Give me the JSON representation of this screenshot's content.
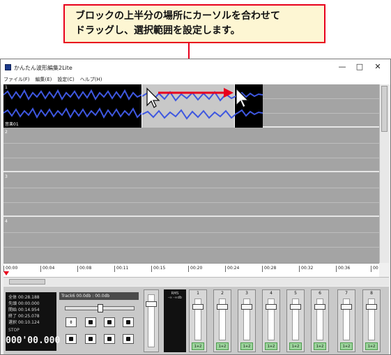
{
  "callout": {
    "line1": "ブロックの上半分の場所にカーソルを合わせて",
    "line2": "ドラッグし、選択範囲を設定します。"
  },
  "window": {
    "title": "かんたん波形編集2Lite",
    "minimize": "—",
    "maximize": "□",
    "close": "✕"
  },
  "menu": [
    "ファイル(F)",
    "編集(E)",
    "設定(C)",
    "ヘルプ(H)"
  ],
  "tracks": [
    {
      "num": "1",
      "label": "音楽01"
    },
    {
      "num": "2"
    },
    {
      "num": "3"
    },
    {
      "num": "4"
    }
  ],
  "ruler": [
    "00:00",
    "00:04",
    "00:08",
    "00:11",
    "00:15",
    "00:20",
    "00:24",
    "00:28",
    "00:32",
    "00:36",
    "00"
  ],
  "time_panel": {
    "rows": [
      {
        "label": "全体",
        "value": "00:28.188"
      },
      {
        "label": "先頭",
        "value": "00:00.000"
      },
      {
        "label": "開始",
        "value": "00:14.954"
      },
      {
        "label": "終了",
        "value": "00:25.078"
      },
      {
        "label": "選択",
        "value": "00:10.124"
      }
    ],
    "status": "STOP",
    "counter": "000'00.000"
  },
  "track_info": "Track6 00.0db : 00.0db",
  "rms": {
    "label": "RMS",
    "value": "-∞ -∞db"
  },
  "mixer": [
    {
      "num": "1",
      "chip": "1+2"
    },
    {
      "num": "2",
      "chip": "1+2"
    },
    {
      "num": "3",
      "chip": "1+2"
    },
    {
      "num": "4",
      "chip": "1+2"
    },
    {
      "num": "5",
      "chip": "1+2"
    },
    {
      "num": "6",
      "chip": "1+2"
    },
    {
      "num": "7",
      "chip": "1+2"
    },
    {
      "num": "8",
      "chip": "1+2"
    }
  ],
  "colors": {
    "accent": "#e8001c",
    "waveform": "#3e57e0",
    "callout_bg": "#fdf6d3"
  }
}
